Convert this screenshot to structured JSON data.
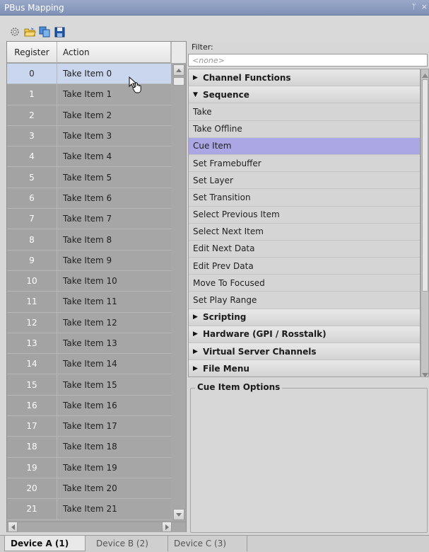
{
  "window": {
    "title": "PBus Mapping",
    "pin_glyph": "ᛘ",
    "close_glyph": "×"
  },
  "toolbar": {
    "buttons": [
      {
        "icon": "settings-gear-icon"
      },
      {
        "icon": "open-folder-icon"
      },
      {
        "icon": "copy-icon"
      },
      {
        "icon": "save-icon"
      }
    ]
  },
  "grid": {
    "headers": {
      "register": "Register",
      "action": "Action"
    },
    "rows": [
      {
        "reg": "0",
        "action": "Take Item 0",
        "selected": true
      },
      {
        "reg": "1",
        "action": "Take Item 1"
      },
      {
        "reg": "2",
        "action": "Take Item 2"
      },
      {
        "reg": "3",
        "action": "Take Item 3"
      },
      {
        "reg": "4",
        "action": "Take Item 4"
      },
      {
        "reg": "5",
        "action": "Take Item 5"
      },
      {
        "reg": "6",
        "action": "Take Item 6"
      },
      {
        "reg": "7",
        "action": "Take Item 7"
      },
      {
        "reg": "8",
        "action": "Take Item 8"
      },
      {
        "reg": "9",
        "action": "Take Item 9"
      },
      {
        "reg": "10",
        "action": "Take Item 10"
      },
      {
        "reg": "11",
        "action": "Take Item 11"
      },
      {
        "reg": "12",
        "action": "Take Item 12"
      },
      {
        "reg": "13",
        "action": "Take Item 13"
      },
      {
        "reg": "14",
        "action": "Take Item 14"
      },
      {
        "reg": "15",
        "action": "Take Item 15"
      },
      {
        "reg": "16",
        "action": "Take Item 16"
      },
      {
        "reg": "17",
        "action": "Take Item 17"
      },
      {
        "reg": "18",
        "action": "Take Item 18"
      },
      {
        "reg": "19",
        "action": "Take Item 19"
      },
      {
        "reg": "20",
        "action": "Take Item 20"
      },
      {
        "reg": "21",
        "action": "Take Item 21"
      }
    ]
  },
  "filter": {
    "label": "Filter:",
    "placeholder": "<none>"
  },
  "tree": [
    {
      "label": "Channel Functions",
      "group": true,
      "expanded": false
    },
    {
      "label": "Sequence",
      "group": true,
      "expanded": true
    },
    {
      "label": "Take"
    },
    {
      "label": "Take Offline"
    },
    {
      "label": "Cue Item",
      "selected": true
    },
    {
      "label": "Set Framebuffer"
    },
    {
      "label": "Set Layer"
    },
    {
      "label": "Set Transition"
    },
    {
      "label": "Select Previous Item"
    },
    {
      "label": "Select Next Item"
    },
    {
      "label": "Edit Next Data"
    },
    {
      "label": "Edit Prev Data"
    },
    {
      "label": "Move To Focused"
    },
    {
      "label": "Set Play Range"
    },
    {
      "label": "Scripting",
      "group": true,
      "expanded": false
    },
    {
      "label": "Hardware (GPI / Rosstalk)",
      "group": true,
      "expanded": false
    },
    {
      "label": "Virtual Server Channels",
      "group": true,
      "expanded": false
    },
    {
      "label": "File Menu",
      "group": true,
      "expanded": false
    }
  ],
  "options": {
    "title": "Cue Item Options"
  },
  "tabs": [
    {
      "label": "Device A (1)",
      "active": true
    },
    {
      "label": "Device B (2)"
    },
    {
      "label": "Device C (3)"
    }
  ],
  "colors": {
    "title_bar": "#8797bd",
    "selection": "#aaa7e4",
    "row_selected": "#c9d6ee"
  }
}
